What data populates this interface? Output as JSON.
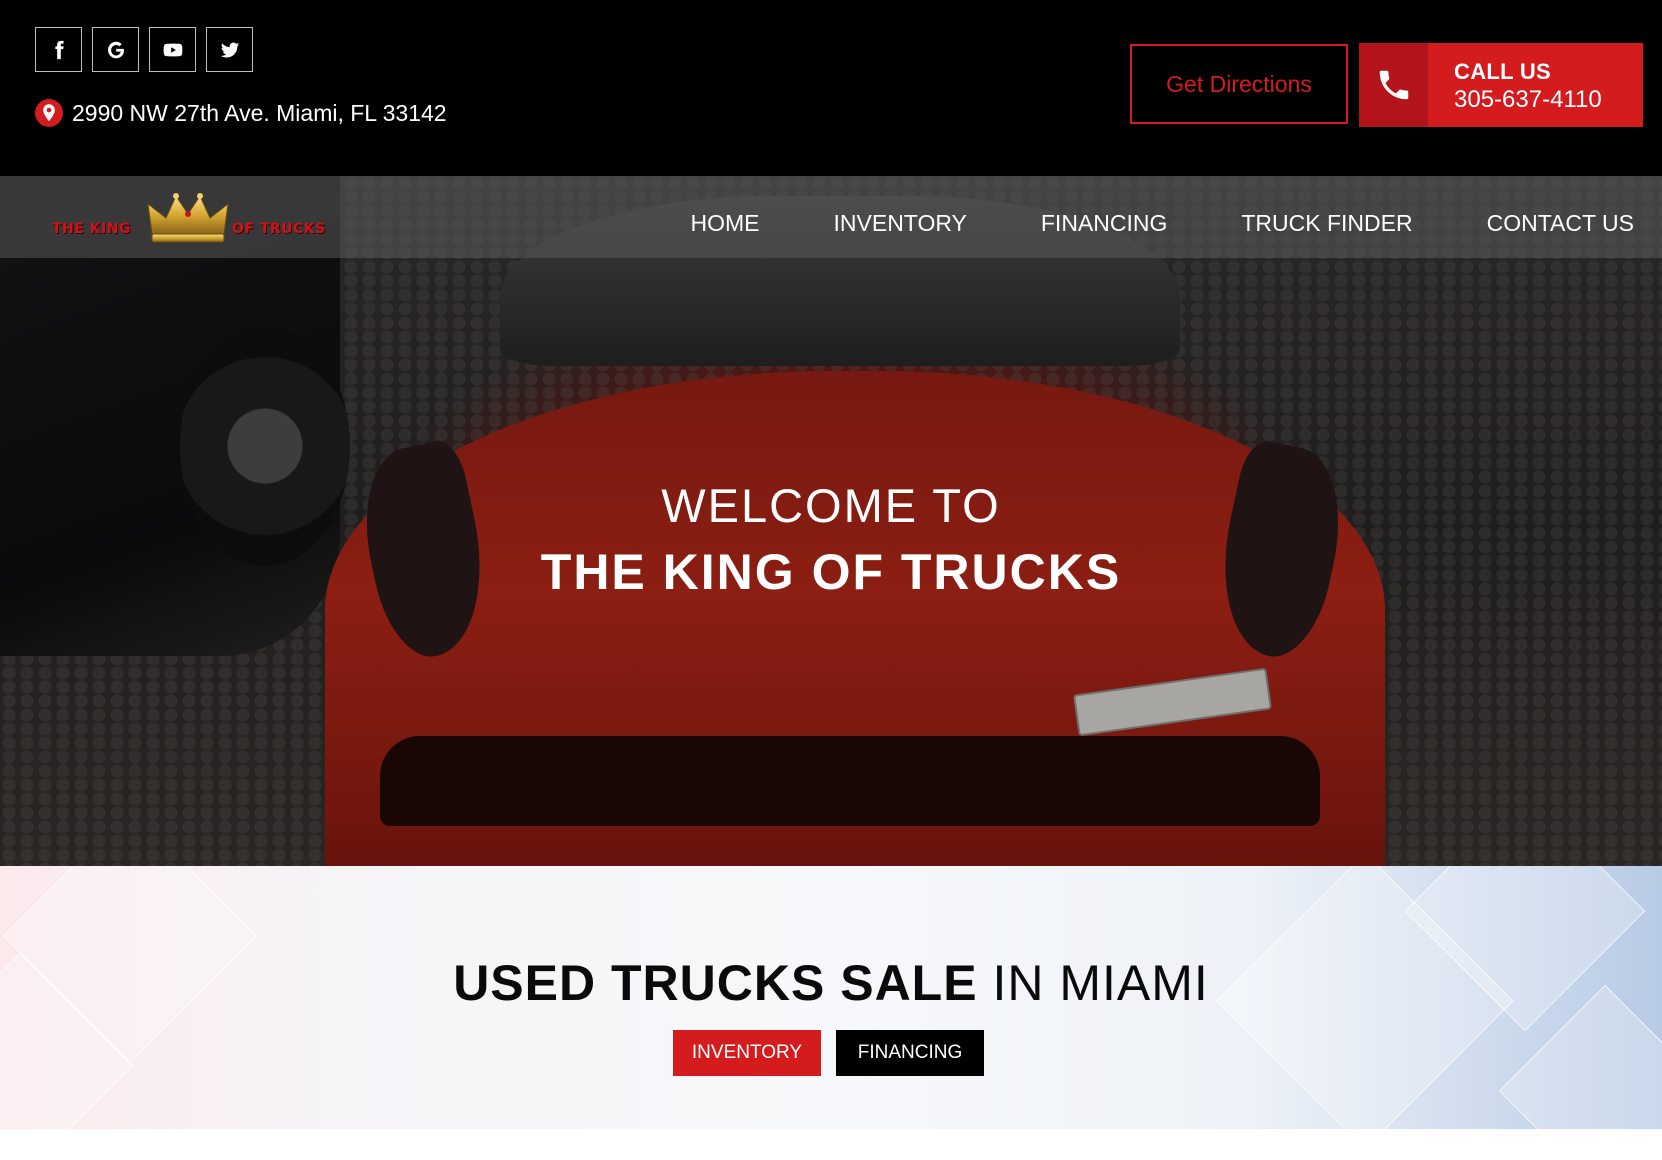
{
  "colors": {
    "brand_red": "#d41c1f",
    "dark_red": "#b3141b",
    "topbar_bg": "#000000"
  },
  "header": {
    "socials": [
      {
        "name": "facebook-icon"
      },
      {
        "name": "google-icon"
      },
      {
        "name": "youtube-icon"
      },
      {
        "name": "twitter-icon"
      }
    ],
    "address": "2990 NW 27th Ave. Miami, FL 33142",
    "directions_label": "Get Directions",
    "call_label": "CALL US",
    "call_number": "305-637-4110"
  },
  "nav": {
    "logo_left": "THE KING",
    "logo_right": "OF TRUCKS",
    "items": [
      "HOME",
      "INVENTORY",
      "FINANCING",
      "TRUCK FINDER",
      "CONTACT US"
    ]
  },
  "hero": {
    "line1": "WELCOME TO",
    "line2": "THE KING OF TRUCKS"
  },
  "sale": {
    "title_bold": "USED TRUCKS SALE",
    "title_rest": " IN MIAMI",
    "buttons": [
      "INVENTORY",
      "FINANCING"
    ]
  }
}
